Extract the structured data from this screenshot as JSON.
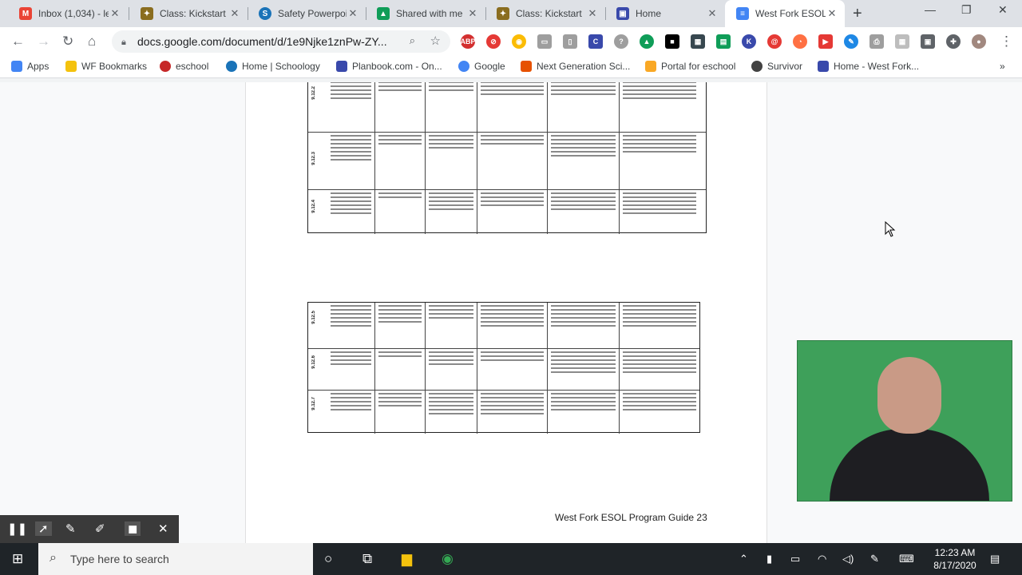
{
  "tabs": [
    {
      "label": "Inbox (1,034) - le",
      "icon": "gmail-icon",
      "color": "#ea4335",
      "glyph": "M"
    },
    {
      "label": "Class: Kickstart",
      "icon": "schoology-class-icon",
      "color": "#8a6d1f",
      "glyph": "✦"
    },
    {
      "label": "Safety Powerpoi",
      "icon": "schoology-icon",
      "color": "#1a73b8",
      "glyph": "S"
    },
    {
      "label": "Shared with me",
      "icon": "google-drive-icon",
      "color": "#0f9d58",
      "glyph": "▲"
    },
    {
      "label": "Class: Kickstart",
      "icon": "schoology-class-icon",
      "color": "#8a6d1f",
      "glyph": "✦"
    },
    {
      "label": "Home",
      "icon": "planbook-icon",
      "color": "#3949ab",
      "glyph": "▣"
    },
    {
      "label": "West Fork ESOL",
      "icon": "google-docs-icon",
      "color": "#4285f4",
      "glyph": "≡"
    }
  ],
  "address": {
    "url": "docs.google.com/document/d/1e9Njke1znPw-ZY..."
  },
  "bookmarks": [
    {
      "label": "Apps",
      "icon": "apps-grid-icon",
      "color": "#4285f4"
    },
    {
      "label": "WF Bookmarks",
      "icon": "folder-icon",
      "color": "#f4c20d"
    },
    {
      "label": "eschool",
      "icon": "eschool-icon",
      "color": "#c62828"
    },
    {
      "label": "Home | Schoology",
      "icon": "schoology-icon",
      "color": "#1a73b8"
    },
    {
      "label": "Planbook.com - On...",
      "icon": "planbook-icon",
      "color": "#3949ab"
    },
    {
      "label": "Google",
      "icon": "google-icon",
      "color": "#4285f4"
    },
    {
      "label": "Next Generation Sci...",
      "icon": "ngss-icon",
      "color": "#e65100"
    },
    {
      "label": "Portal for eschool",
      "icon": "portal-icon",
      "color": "#f9a825"
    },
    {
      "label": "Survivor",
      "icon": "survivor-icon",
      "color": "#424242"
    },
    {
      "label": "Home - West Fork...",
      "icon": "planbook-icon",
      "color": "#3949ab"
    }
  ],
  "document": {
    "footer": "West Fork ESOL Program Guide 23",
    "table_top_rows": [
      "9.12.2",
      "9.12.3",
      "9.12.4"
    ],
    "table_bottom_rows": [
      "9.12.5",
      "9.12.6",
      "9.12.7"
    ]
  },
  "recorder": {
    "tools": [
      "pause-icon",
      "pointer-icon",
      "pen-icon",
      "highlighter-icon",
      "camera-icon",
      "close-icon"
    ]
  },
  "taskbar": {
    "search_placeholder": "Type here to search",
    "time": "12:23 AM",
    "date": "8/17/2020"
  }
}
